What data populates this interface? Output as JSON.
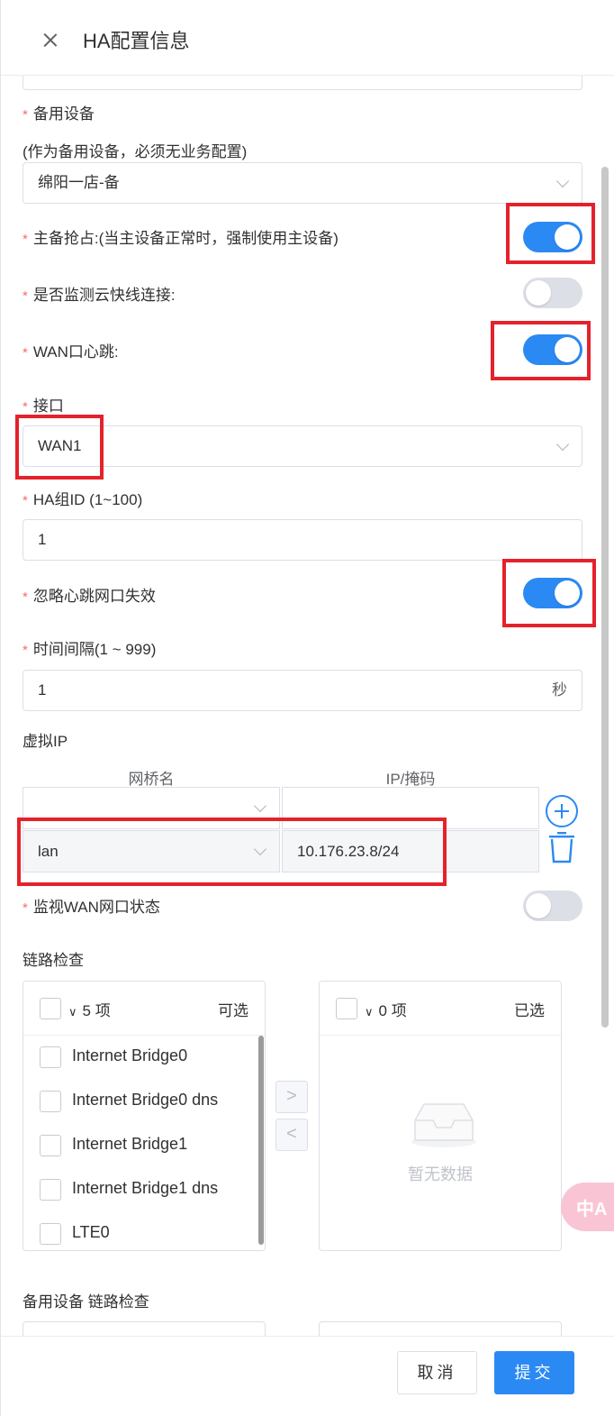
{
  "header": {
    "title": "HA配置信息"
  },
  "form": {
    "required_mark": "*",
    "backup_device": {
      "label": "备用设备",
      "hint": "(作为备用设备，必须无业务配置)",
      "value": "绵阳一店-备"
    },
    "preempt": {
      "label": "主备抢占:(当主设备正常时，强制使用主设备)",
      "on": true
    },
    "monitor_cloud": {
      "label": "是否监测云快线连接:",
      "on": false
    },
    "wan_heartbeat": {
      "label": "WAN口心跳:",
      "on": true
    },
    "interface": {
      "label": "接口",
      "value": "WAN1"
    },
    "ha_group_id": {
      "label": "HA组ID (1~100)",
      "value": "1"
    },
    "ignore_heartbeat_fail": {
      "label": "忽略心跳网口失效",
      "on": true
    },
    "interval": {
      "label": "时间间隔(1 ~ 999)",
      "value": "1",
      "unit": "秒"
    },
    "virtual_ip": {
      "label": "虚拟IP",
      "col_bridge": "网桥名",
      "col_ip": "IP/掩码",
      "rows": [
        {
          "bridge": "",
          "ip": ""
        },
        {
          "bridge": "lan",
          "ip": "10.176.23.8/24"
        }
      ]
    },
    "monitor_wan": {
      "label": "监视WAN网口状态",
      "on": false
    },
    "link_check": {
      "label": "链路检查",
      "left": {
        "count": "5 项",
        "tag": "可选",
        "items": [
          "Internet Bridge0",
          "Internet Bridge0 dns",
          "Internet Bridge1",
          "Internet Bridge1 dns",
          "LTE0"
        ]
      },
      "right": {
        "count": "0 项",
        "tag": "已选",
        "empty": "暂无数据"
      },
      "btn_right": ">",
      "btn_left": "<"
    },
    "backup_link_check": {
      "label": "备用设备 链路检查"
    }
  },
  "footer": {
    "cancel": "取消",
    "submit": "提交"
  },
  "fab": {
    "label": "中A"
  },
  "colors": {
    "primary": "#2b89f4",
    "highlight": "#e5222b",
    "required": "#f56c6c"
  }
}
